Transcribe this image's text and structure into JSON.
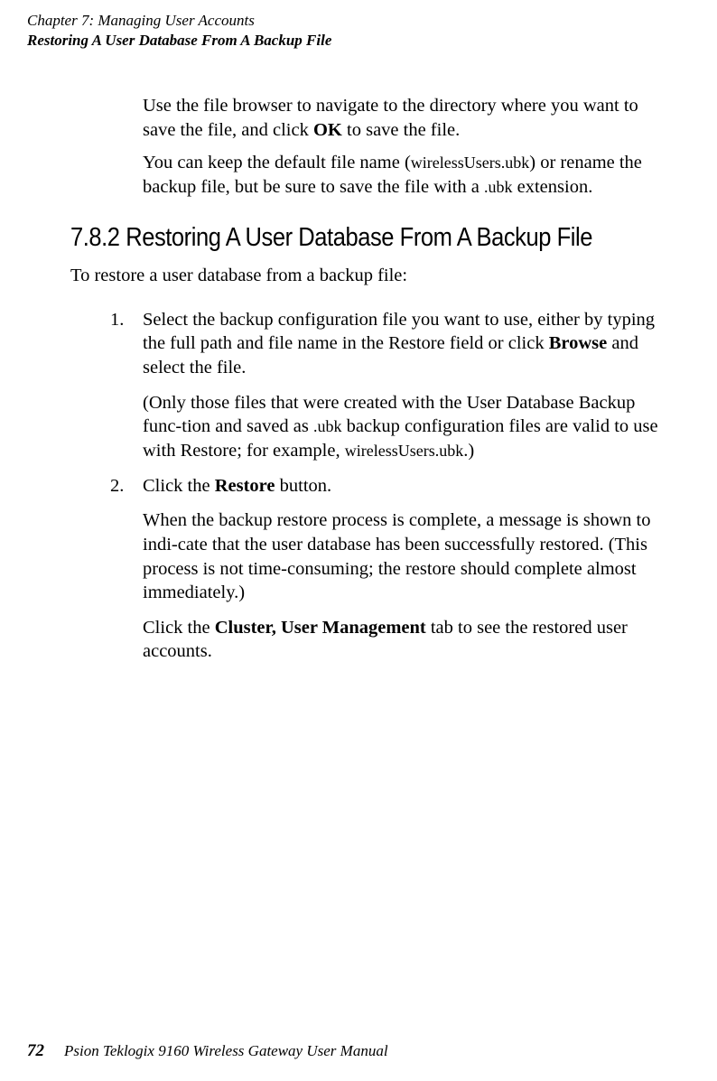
{
  "header": {
    "chapter": "Chapter 7:  Managing User Accounts",
    "section": "Restoring A User Database From A Backup File"
  },
  "content": {
    "para1_a": "Use the file browser to navigate to the directory where you want to save the file, and click ",
    "para1_bold": "OK",
    "para1_b": " to save the file.",
    "para2_a": "You can keep the default file name (",
    "para2_small1": "wirelessUsers.ubk",
    "para2_b": ") or rename the backup file, but be sure to save the file with a ",
    "para2_small2": ".ubk",
    "para2_c": " extension.",
    "heading": "7.8.2  Restoring A User Database From A Backup File",
    "intro": "To restore a user database from a backup file:",
    "item1_marker": "1.",
    "item1_a": "Select the backup configuration file you want to use, either by typing the full path and file name in the Restore field or click ",
    "item1_bold": "Browse",
    "item1_b": " and select the file.",
    "item1_note_a": "(Only those files that were created with the User Database Backup func-tion and saved as ",
    "item1_note_small1": ".ubk",
    "item1_note_b": " backup configuration files are valid to use with Restore; for example, ",
    "item1_note_small2": "wirelessUsers.ubk",
    "item1_note_c": ".)",
    "item2_marker": "2.",
    "item2_a": "Click the ",
    "item2_bold": "Restore",
    "item2_b": " button.",
    "item2_para2": "When the backup restore process is complete, a message is shown to indi-cate that the user database has been successfully restored. (This process is not time-consuming; the restore should complete almost immediately.)",
    "item2_para3_a": "Click the ",
    "item2_para3_bold": "Cluster, User Management",
    "item2_para3_b": " tab to see the restored user accounts."
  },
  "footer": {
    "page": "72",
    "text": "Psion Teklogix 9160 Wireless Gateway User Manual"
  }
}
